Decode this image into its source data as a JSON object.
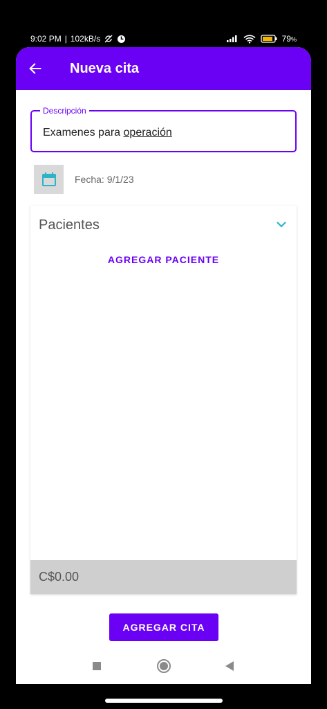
{
  "status_bar": {
    "time": "9:02 PM",
    "network_speed": "102kB/s",
    "battery": "79"
  },
  "appbar": {
    "title": "Nueva cita",
    "back_icon": "arrow-back-icon"
  },
  "description": {
    "label": "Descripción",
    "value_start": "Examenes para ",
    "value_underlined": "operación"
  },
  "date": {
    "icon": "calendar-icon",
    "text": "Fecha: 9/1/23"
  },
  "patients": {
    "title": "Pacientes",
    "expand_icon": "chevron-down-icon",
    "add_label": "AGREGAR PACIENTE",
    "total": "C$0.00"
  },
  "actions": {
    "add_appointment_label": "AGREGAR CITA"
  },
  "nav": {
    "recents_icon": "square-icon",
    "home_icon": "circle-icon",
    "back_icon": "triangle-back-icon"
  },
  "colors": {
    "primary": "#6a00f4",
    "calendar_accent": "#2bb3c8"
  }
}
